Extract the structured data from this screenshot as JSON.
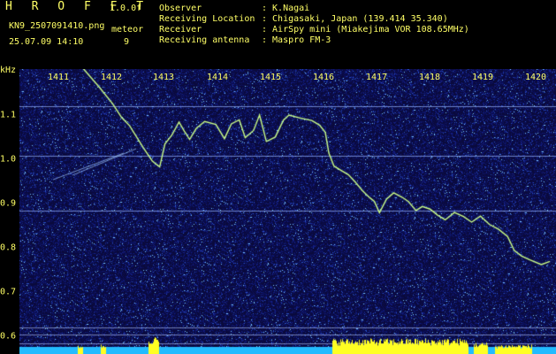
{
  "header": {
    "software_title": "H R O F F T",
    "version": "1.0.0f",
    "file_name": "KN9_2507091410.png",
    "timestamp": "25.07.09 14:10",
    "meteor_label": "meteor",
    "meteor_count": "9"
  },
  "info": {
    "observer_label": "Observer",
    "observer_value": ": K.Nagai",
    "location_label": "Receiving Location",
    "location_value": ": Chigasaki, Japan (139.414 35.340)",
    "receiver_label": "Receiver",
    "receiver_value": ": AirSpy mini (Miakejima VOR 108.65MHz)",
    "antenna_label": "Receiving antenna",
    "antenna_value": ": Maspro FM-3"
  },
  "spectrogram": {
    "freq_unit": "kHz",
    "freq_ticks": [
      "1.1",
      "1.0",
      "0.9",
      "0.8",
      "0.7",
      "0.6"
    ],
    "time_ticks": [
      "1411",
      "1412",
      "1413",
      "1414",
      "1415",
      "1416",
      "1417",
      "1418",
      "1419",
      "1420"
    ],
    "colors": {
      "background": "#000000",
      "noise_base": "#0a0a3c",
      "trace": "#ccff88",
      "bar_cyan": "#22bbff",
      "bar_yellow": "#ffff22",
      "label": "#ffff66"
    }
  }
}
